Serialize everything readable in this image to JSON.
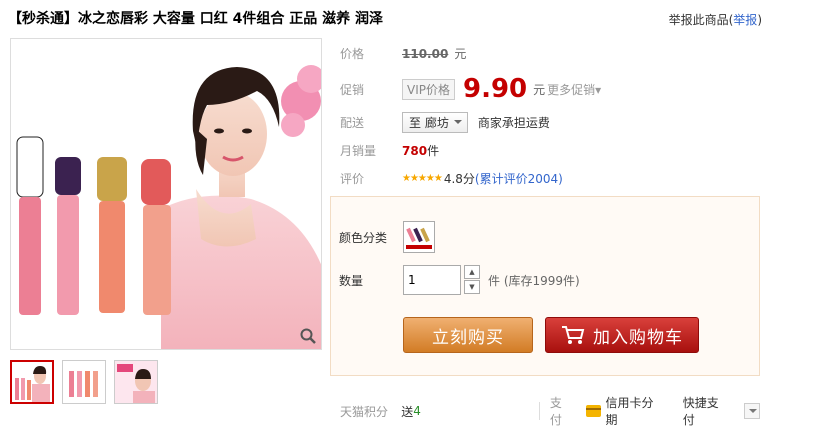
{
  "product": {
    "title": "【秒杀通】冰之恋唇彩 大容量 口红 4件组合 正品 滋养 润泽",
    "report_text": "举报此商品",
    "report_link": "举报"
  },
  "price": {
    "label": "价格",
    "original": "110.00",
    "unit": "元"
  },
  "promo": {
    "label": "促销",
    "vip_tag": "VIP价格",
    "value": "9.90",
    "unit": "元",
    "more": "更多促销▾"
  },
  "shipping": {
    "label": "配送",
    "region": "至 廊坊",
    "note": "商家承担运费"
  },
  "sales": {
    "label": "月销量",
    "count": "780",
    "unit": "件"
  },
  "rating": {
    "label": "评价",
    "stars": "★★★★★",
    "score": "4.8分",
    "reviews": "(累计评价2004)"
  },
  "sku": {
    "color_label": "颜色分类",
    "qty_label": "数量",
    "qty_value": "1",
    "stepper_up": "▲",
    "stepper_down": "▼",
    "stock": "件 (库存1999件)"
  },
  "buttons": {
    "buy_now": "立刻购买",
    "add_cart": "加入购物车"
  },
  "bottom": {
    "points_label": "天猫积分",
    "points_prefix": "送",
    "points_value": "4",
    "pay_label": "支付",
    "card_installment": "信用卡分期",
    "quick_pay": "快捷支付"
  },
  "colors": {
    "accent_red": "#c40000",
    "buy_orange": "#d27c25",
    "cart_red": "#a8100e",
    "link_blue": "#3366cc"
  }
}
